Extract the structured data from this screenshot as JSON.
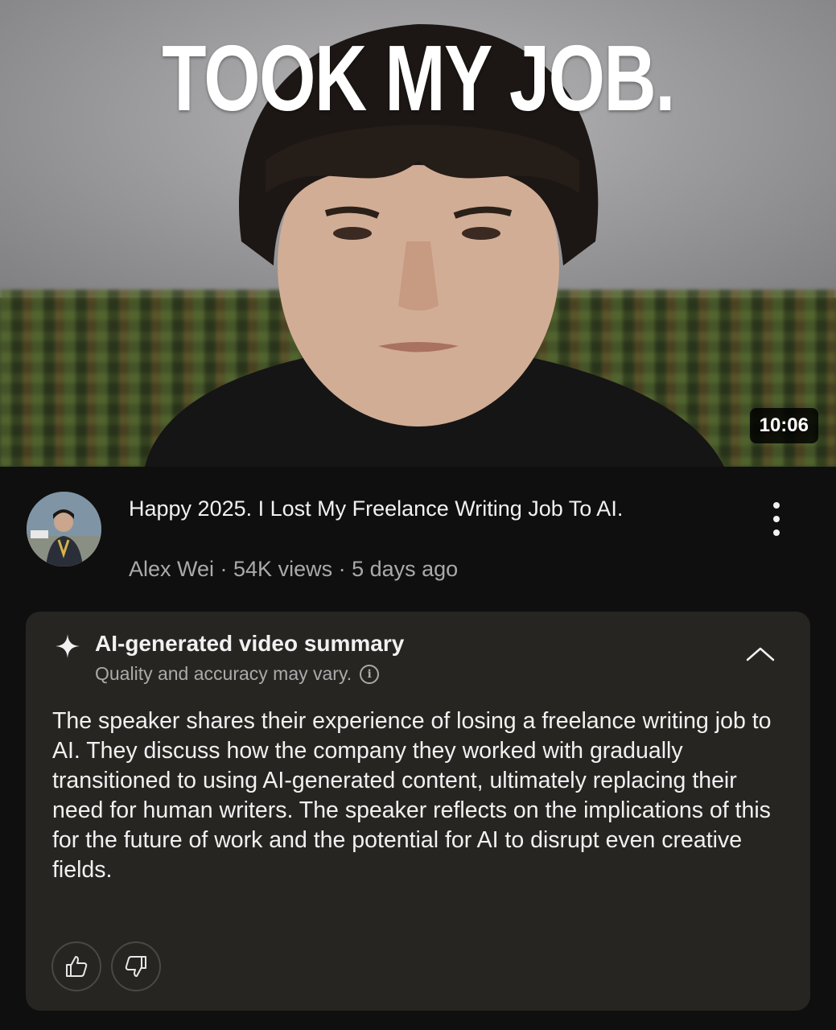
{
  "video": {
    "thumbnail_text": "TOOK MY JOB.",
    "duration": "10:06",
    "title": "Happy 2025. I Lost My Freelance Writing Job To AI.",
    "channel": "Alex Wei",
    "views": "54K views",
    "age": "5 days ago",
    "channel_line": "Alex Wei · 54K views · 5 days ago"
  },
  "icons": {
    "more": "more-vert-icon",
    "sparkle": "sparkle-icon",
    "info": "info-icon",
    "collapse": "chevron-up-icon",
    "like": "thumbs-up-icon",
    "dislike": "thumbs-down-icon"
  },
  "summary": {
    "heading": "AI-generated video summary",
    "disclaimer": "Quality and accuracy may vary.",
    "info_glyph": "i",
    "body": "The speaker shares their experience of losing a freelance writing job to AI. They discuss how the company they worked with gradually transitioned to using AI-generated content, ultimately replacing their need for human writers. The speaker reflects on the implications of this for the future of work and the potential for AI to disrupt even creative fields."
  },
  "colors": {
    "background": "#0f0f0f",
    "card": "#272522",
    "text_primary": "#f1f1f1",
    "text_secondary": "#aaaaaa"
  }
}
